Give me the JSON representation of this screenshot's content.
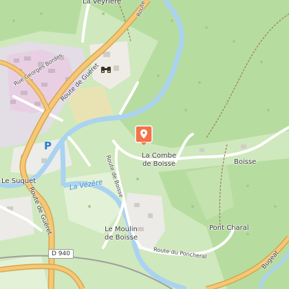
{
  "map": {
    "places": {
      "veyriere": "La Veyrière",
      "le_suquet": "Le Suquet",
      "la_combe_de_boisse_line1": "La Combe",
      "la_combe_de_boisse_line2": "de Boisse",
      "boisse": "Boisse",
      "le_moulin_line1": "Le Moulin",
      "le_moulin_line2": "de Boisse",
      "pont_charal": "Pont Charal",
      "bugeat": "Bugeat"
    },
    "roads": {
      "rue_georges_borde": "Rue Georges Bordes",
      "route_de_gueret_north": "Route de Guéret",
      "route_de_gueret_south": "Route de Guéret",
      "route_de_boisse": "Route de Boisse",
      "route_du_poncheral": "Route du Poncheral",
      "route_de_top": "Route de",
      "shield_d940": "D 940"
    },
    "water": {
      "la_vezere": "La Vézère"
    },
    "poi": {
      "parking": "P",
      "marker_icon": "map-pin-icon",
      "viewpoint_icon": "binoculars-icon",
      "marker_color": "#f2734a"
    }
  }
}
